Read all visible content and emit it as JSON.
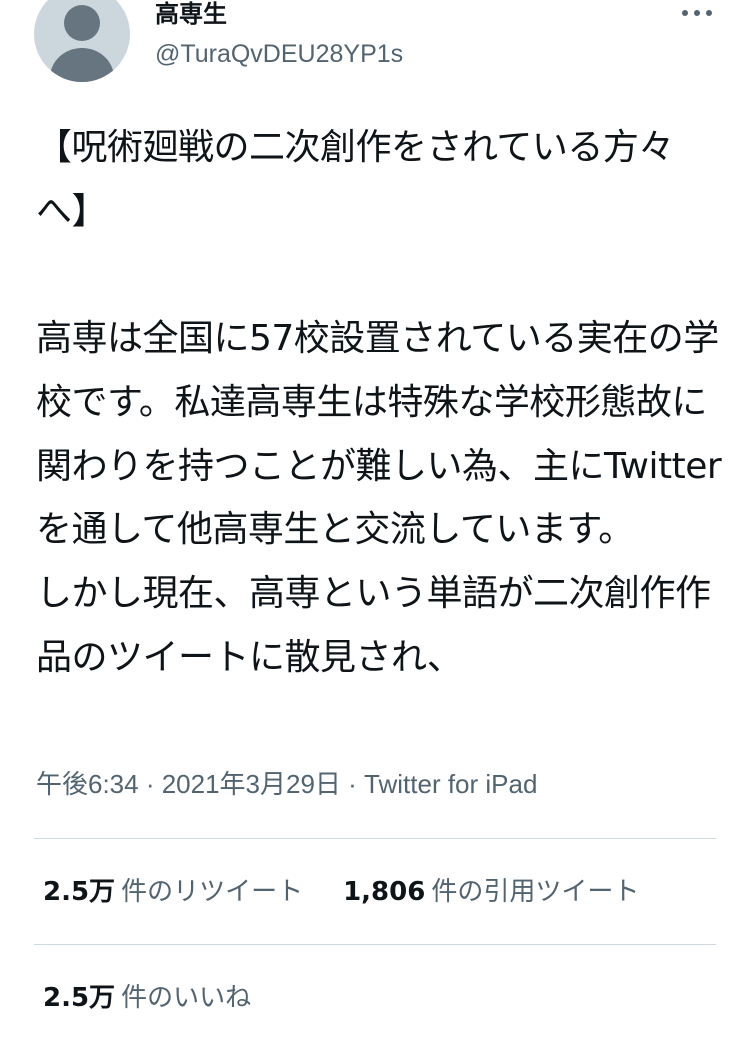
{
  "user": {
    "display_name": "高専生",
    "handle": "@TuraQvDEU28YP1s",
    "avatar": "default-avatar-icon"
  },
  "more_icon": "more-horizontal-icon",
  "tweet": {
    "text": "【呪術廻戦の二次創作をされている方々へ】\n\n高専は全国に57校設置されている実在の学校です。私達高専生は特殊な学校形態故に関わりを持つことが難しい為、主にTwitterを通して他高専生と交流しています。\nしかし現在、高専という単語が二次創作作品のツイートに散見され、"
  },
  "meta": {
    "text": "午後6:34 · 2021年3月29日 · Twitter for iPad"
  },
  "stats": {
    "retweets": {
      "count": "2.5万",
      "label": "件のリツイート"
    },
    "quotes": {
      "count": "1,806",
      "label": "件の引用ツイート"
    },
    "likes": {
      "count": "2.5万",
      "label": "件のいいね"
    }
  },
  "colors": {
    "text": "#0f1419",
    "secondary": "#536471",
    "divider": "#cfd9de",
    "avatar_bg": "#ccd6dd",
    "avatar_fg": "#66757f"
  }
}
